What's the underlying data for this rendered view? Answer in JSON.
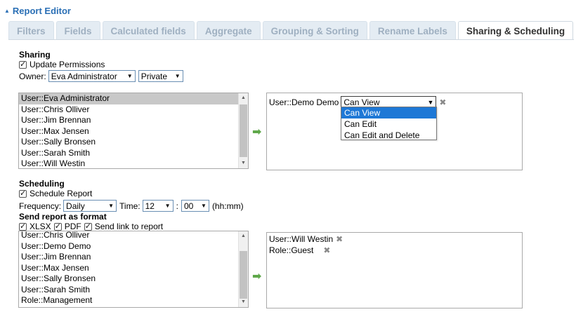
{
  "header": {
    "title": "Report Editor"
  },
  "tabs": [
    {
      "label": "Filters"
    },
    {
      "label": "Fields"
    },
    {
      "label": "Calculated fields"
    },
    {
      "label": "Aggregate"
    },
    {
      "label": "Grouping & Sorting"
    },
    {
      "label": "Rename Labels"
    },
    {
      "label": "Sharing & Scheduling"
    }
  ],
  "sharing": {
    "title": "Sharing",
    "update_permissions_label": "Update Permissions",
    "update_permissions_checked": true,
    "owner_label": "Owner:",
    "owner_value": "Eva Administrator",
    "visibility_value": "Private",
    "users": [
      "User::Eva Administrator",
      "User::Chris Olliver",
      "User::Jim Brennan",
      "User::Max Jensen",
      "User::Sally Bronsen",
      "User::Sarah Smith",
      "User::Will Westin"
    ],
    "selected_user": "User::Eva Administrator",
    "shared_entry": {
      "name": "User::Demo Demo",
      "permission": "Can View"
    },
    "permission_options": [
      "Can View",
      "Can Edit",
      "Can Edit and Delete"
    ],
    "highlighted_option": "Can View"
  },
  "scheduling": {
    "title": "Scheduling",
    "schedule_label": "Schedule Report",
    "schedule_checked": true,
    "frequency_label": "Frequency:",
    "frequency_value": "Daily",
    "time_label": "Time:",
    "hour_value": "12",
    "colon": ":",
    "minute_value": "00",
    "time_hint": "(hh:mm)",
    "format_title": "Send report as format",
    "formats": [
      {
        "label": "XLSX",
        "checked": true
      },
      {
        "label": "PDF",
        "checked": true
      },
      {
        "label": "Send link to report",
        "checked": true
      }
    ],
    "recipients_available": [
      "User::Chris Olliver",
      "User::Demo Demo",
      "User::Jim Brennan",
      "User::Max Jensen",
      "User::Sally Bronsen",
      "User::Sarah Smith",
      "Role::Management"
    ],
    "recipients_selected": [
      "User::Will Westin",
      "Role::Guest"
    ]
  },
  "colors": {
    "header_blue": "#2a6fb5",
    "tab_inactive_bg": "#e4ecf3",
    "tab_inactive_text": "#9fb0c1",
    "arrow_green": "#5fa84a",
    "option_highlight": "#1e78d6"
  }
}
